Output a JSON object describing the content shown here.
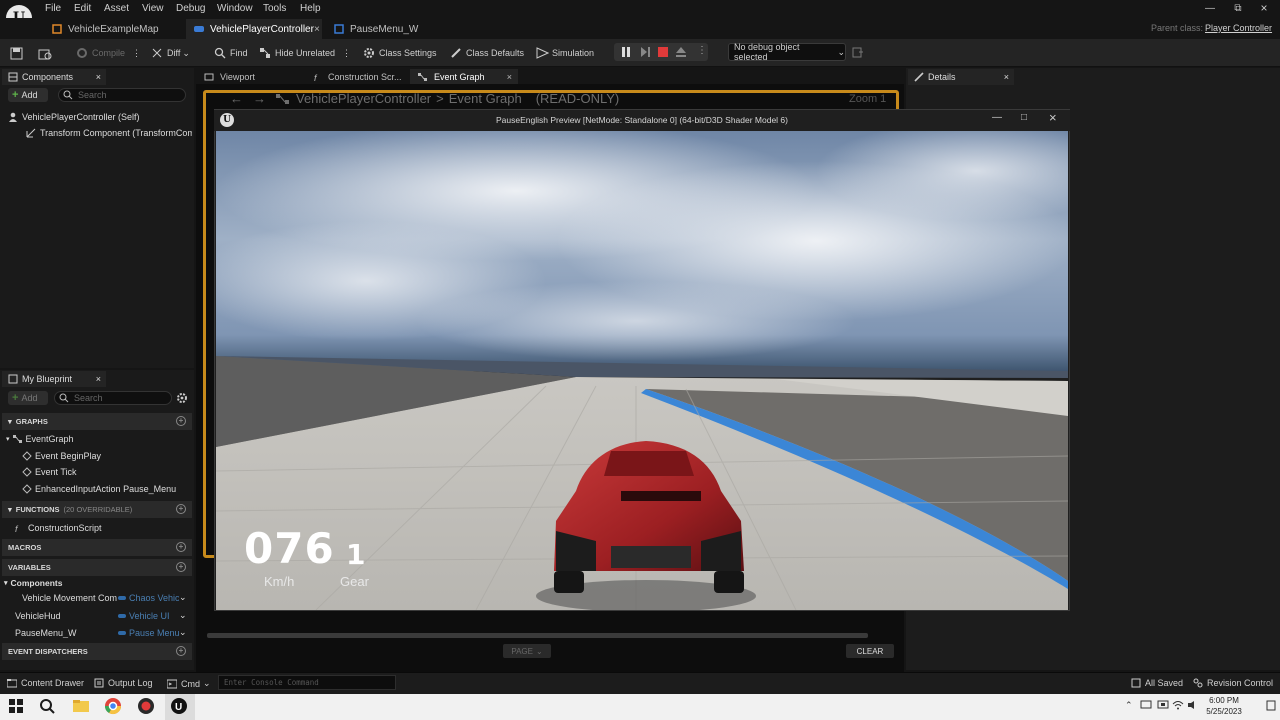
{
  "menu": {
    "items": [
      "File",
      "Edit",
      "Asset",
      "View",
      "Debug",
      "Window",
      "Tools",
      "Help"
    ],
    "parent_class_label": "Parent class:",
    "parent_class_value": "Player Controller"
  },
  "doc_tabs": [
    {
      "label": "VehicleExampleMap"
    },
    {
      "label": "VehiclePlayerController"
    },
    {
      "label": "PauseMenu_W"
    }
  ],
  "toolbar": {
    "compile": "Compile",
    "diff": "Diff",
    "find": "Find",
    "hide_unrelated": "Hide Unrelated",
    "class_settings": "Class Settings",
    "class_defaults": "Class Defaults",
    "simulation": "Simulation",
    "debug_object": "No debug object selected"
  },
  "components_panel": {
    "tab": "Components",
    "add": "Add",
    "search_placeholder": "Search",
    "root": "VehiclePlayerController (Self)",
    "child": "Transform Component (TransformComp"
  },
  "editor_tabs": {
    "viewport": "Viewport",
    "construction": "Construction Scr...",
    "event_graph": "Event Graph"
  },
  "graph": {
    "breadcrumb_root": "VehiclePlayerController",
    "breadcrumb_sep": ">",
    "breadcrumb_leaf": "Event Graph",
    "readonly": "(READ-ONLY)",
    "zoom": "Zoom 1"
  },
  "details_panel": {
    "tab": "Details"
  },
  "my_blueprint": {
    "tab": "My Blueprint",
    "add": "Add",
    "search_placeholder": "Search",
    "graphs_header": "GRAPHS",
    "event_graph": "EventGraph",
    "events": [
      "Event BeginPlay",
      "Event Tick",
      "EnhancedInputAction Pause_Menu"
    ],
    "functions_header": "FUNCTIONS",
    "functions_count": "(20 OVERRIDABLE)",
    "construction_script": "ConstructionScript",
    "macros_header": "MACROS",
    "variables_header": "VARIABLES",
    "components_header": "Components",
    "variables": [
      {
        "name": "Vehicle Movement Com",
        "type": "Chaos Vehic"
      },
      {
        "name": "VehicleHud",
        "type": "Vehicle UI"
      },
      {
        "name": "PauseMenu_W",
        "type": "Pause Menu"
      }
    ],
    "dispatchers_header": "EVENT DISPATCHERS"
  },
  "preview": {
    "title": "PauseEnglish Preview [NetMode: Standalone 0]  (64-bit/D3D Shader Model 6)",
    "speed": "076",
    "speed_unit": "Km/h",
    "gear": "1",
    "gear_label": "Gear"
  },
  "console": {
    "page": "PAGE",
    "clear": "CLEAR"
  },
  "statusbar": {
    "content_drawer": "Content Drawer",
    "output_log": "Output Log",
    "cmd": "Cmd",
    "console_placeholder": "Enter Console Command",
    "saved": "All Saved",
    "revision": "Revision Control"
  },
  "taskbar": {
    "time": "6:00 PM",
    "date": "5/25/2023"
  },
  "colors": {
    "accent_orange": "#c78a1b",
    "add_green": "#5fb34a",
    "var_blue": "#4a7fb3",
    "record_red": "#e03a3a"
  }
}
